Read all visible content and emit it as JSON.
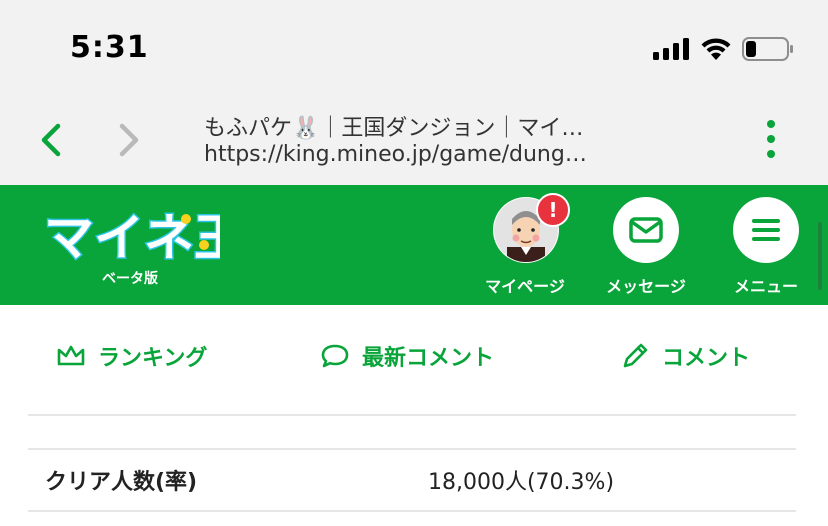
{
  "status_bar": {
    "time": "5:31"
  },
  "browser": {
    "tab_title": "もふパケ🐰｜王国ダンジョン｜マイ…",
    "url": "https://king.mineo.jp/game/dung…"
  },
  "header": {
    "logo_text": "マイネ王",
    "logo_sub": "ベータ版",
    "mypage_label": "マイページ",
    "message_label": "メッセージ",
    "menu_label": "メニュー",
    "alert_badge": "!",
    "brand_color": "#09a43a"
  },
  "actions": {
    "ranking_label": "ランキング",
    "latest_comments_label": "最新コメント",
    "comment_label": "コメント"
  },
  "stats": {
    "clear_label": "クリア人数(率)",
    "clear_value": "18,000人(70.3%)"
  }
}
